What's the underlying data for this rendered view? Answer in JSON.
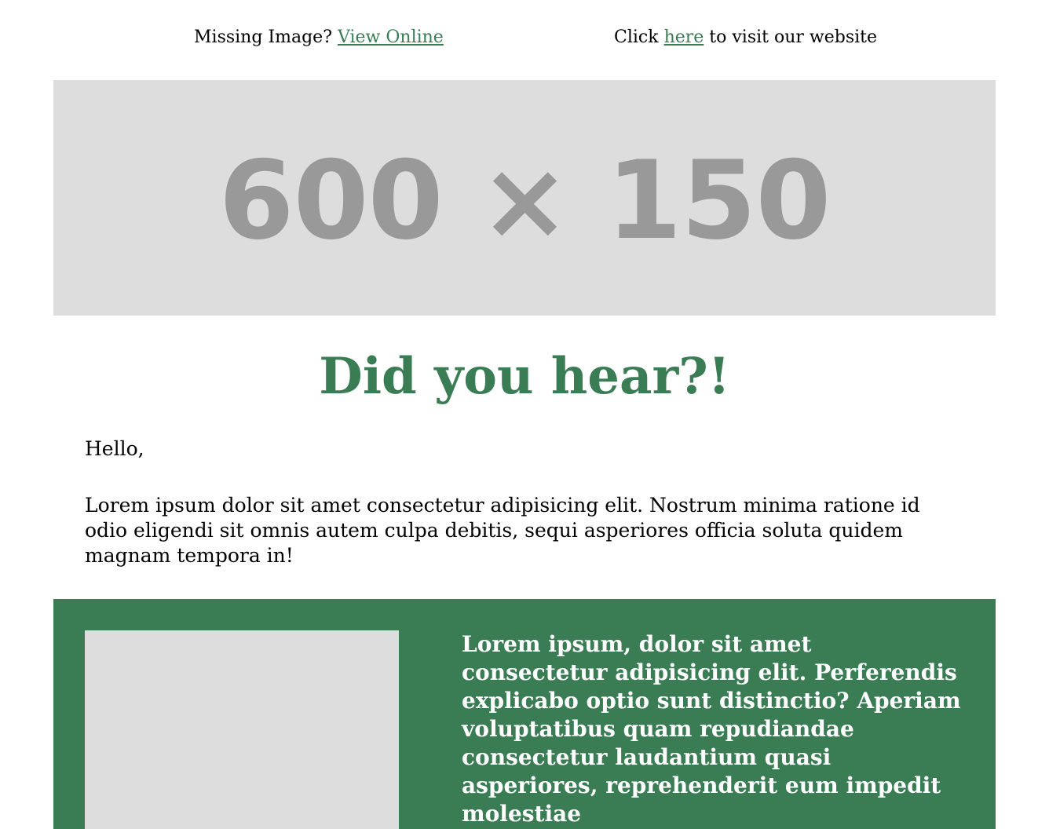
{
  "header": {
    "missing_image_prefix": "Missing Image? ",
    "view_online_label": "View Online",
    "click_prefix": "Click ",
    "here_label": "here",
    "visit_suffix": " to visit our website"
  },
  "hero": {
    "placeholder_label": "600 × 150"
  },
  "headline": "Did you hear?!",
  "greeting": "Hello,",
  "body": "Lorem ipsum dolor sit amet consectetur adipisicing elit. Nostrum minima ratione id odio eligendi sit omnis autem culpa debitis, sequi asperiores officia soluta quidem magnam tempora in!",
  "feature": {
    "text": "Lorem ipsum, dolor sit amet consectetur adipisicing elit. Perferendis explicabo optio sunt distinctio? Aperiam voluptatibus quam repudiandae consectetur laudantium quasi asperiores, reprehenderit eum impedit molestiae"
  },
  "colors": {
    "accent_green": "#3a7d55",
    "placeholder_gray": "#dddddd",
    "placeholder_text_gray": "#999999"
  }
}
